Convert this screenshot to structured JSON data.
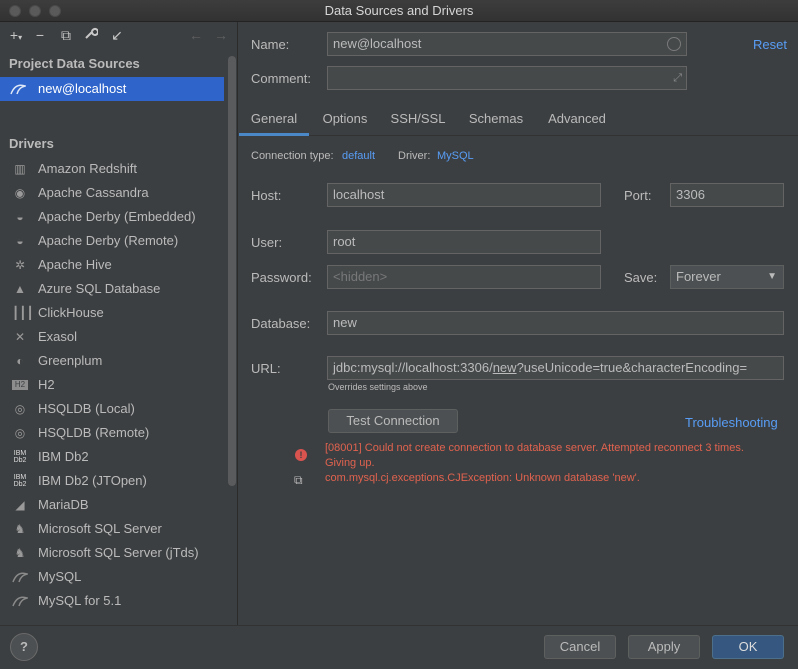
{
  "window": {
    "title": "Data Sources and Drivers"
  },
  "toolbar": {
    "icons": [
      "plus-icon",
      "minus-icon",
      "copy-icon",
      "wrench-icon",
      "import-icon",
      "back-arrow-icon",
      "forward-arrow-icon"
    ]
  },
  "sidebar": {
    "project_header": "Project Data Sources",
    "data_sources": [
      {
        "label": "new@localhost",
        "selected": true
      }
    ],
    "drivers_header": "Drivers",
    "drivers": [
      {
        "label": "Amazon Redshift",
        "icon": "redshift-icon"
      },
      {
        "label": "Apache Cassandra",
        "icon": "cassandra-icon"
      },
      {
        "label": "Apache Derby (Embedded)",
        "icon": "derby-icon"
      },
      {
        "label": "Apache Derby (Remote)",
        "icon": "derby-icon"
      },
      {
        "label": "Apache Hive",
        "icon": "hive-icon"
      },
      {
        "label": "Azure SQL Database",
        "icon": "azure-icon"
      },
      {
        "label": "ClickHouse",
        "icon": "clickhouse-icon"
      },
      {
        "label": "Exasol",
        "icon": "exasol-icon"
      },
      {
        "label": "Greenplum",
        "icon": "greenplum-icon"
      },
      {
        "label": "H2",
        "icon": "h2-icon"
      },
      {
        "label": "HSQLDB (Local)",
        "icon": "hsqldb-icon"
      },
      {
        "label": "HSQLDB (Remote)",
        "icon": "hsqldb-icon"
      },
      {
        "label": "IBM Db2",
        "icon": "db2-icon"
      },
      {
        "label": "IBM Db2 (JTOpen)",
        "icon": "db2-icon"
      },
      {
        "label": "MariaDB",
        "icon": "mariadb-icon"
      },
      {
        "label": "Microsoft SQL Server",
        "icon": "sqlserver-icon"
      },
      {
        "label": "Microsoft SQL Server (jTds)",
        "icon": "sqlserver-icon"
      },
      {
        "label": "MySQL",
        "icon": "mysql-icon"
      },
      {
        "label": "MySQL for 5.1",
        "icon": "mysql-icon"
      }
    ]
  },
  "form": {
    "name_label": "Name:",
    "name_value": "new@localhost",
    "comment_label": "Comment:",
    "comment_value": "",
    "reset_label": "Reset",
    "tabs": [
      {
        "label": "General",
        "active": true
      },
      {
        "label": "Options"
      },
      {
        "label": "SSH/SSL"
      },
      {
        "label": "Schemas"
      },
      {
        "label": "Advanced"
      }
    ],
    "connection_type_label": "Connection type:",
    "connection_type_value": "default",
    "driver_label": "Driver:",
    "driver_value": "MySQL",
    "host_label": "Host:",
    "host_value": "localhost",
    "port_label": "Port:",
    "port_value": "3306",
    "user_label": "User:",
    "user_value": "root",
    "password_label": "Password:",
    "password_placeholder": "<hidden>",
    "save_label": "Save:",
    "save_value": "Forever",
    "database_label": "Database:",
    "database_value": "new",
    "url_label": "URL:",
    "url_prefix": "jdbc:mysql://localhost:3306/",
    "url_db": "new",
    "url_suffix": "?useUnicode=true&characterEncoding=",
    "url_hint": "Overrides settings above",
    "test_connection_label": "Test Connection",
    "troubleshooting_label": "Troubleshooting",
    "error_line1": "[08001] Could not create connection to database server. Attempted reconnect 3 times.",
    "error_line2": "Giving up.",
    "error_line3": "com.mysql.cj.exceptions.CJException: Unknown database 'new'."
  },
  "footer": {
    "help_label": "?",
    "cancel_label": "Cancel",
    "apply_label": "Apply",
    "ok_label": "OK"
  },
  "colors": {
    "accent": "#589df6",
    "selection": "#2f65ca",
    "error": "#e0624f",
    "primary_button": "#365880"
  }
}
